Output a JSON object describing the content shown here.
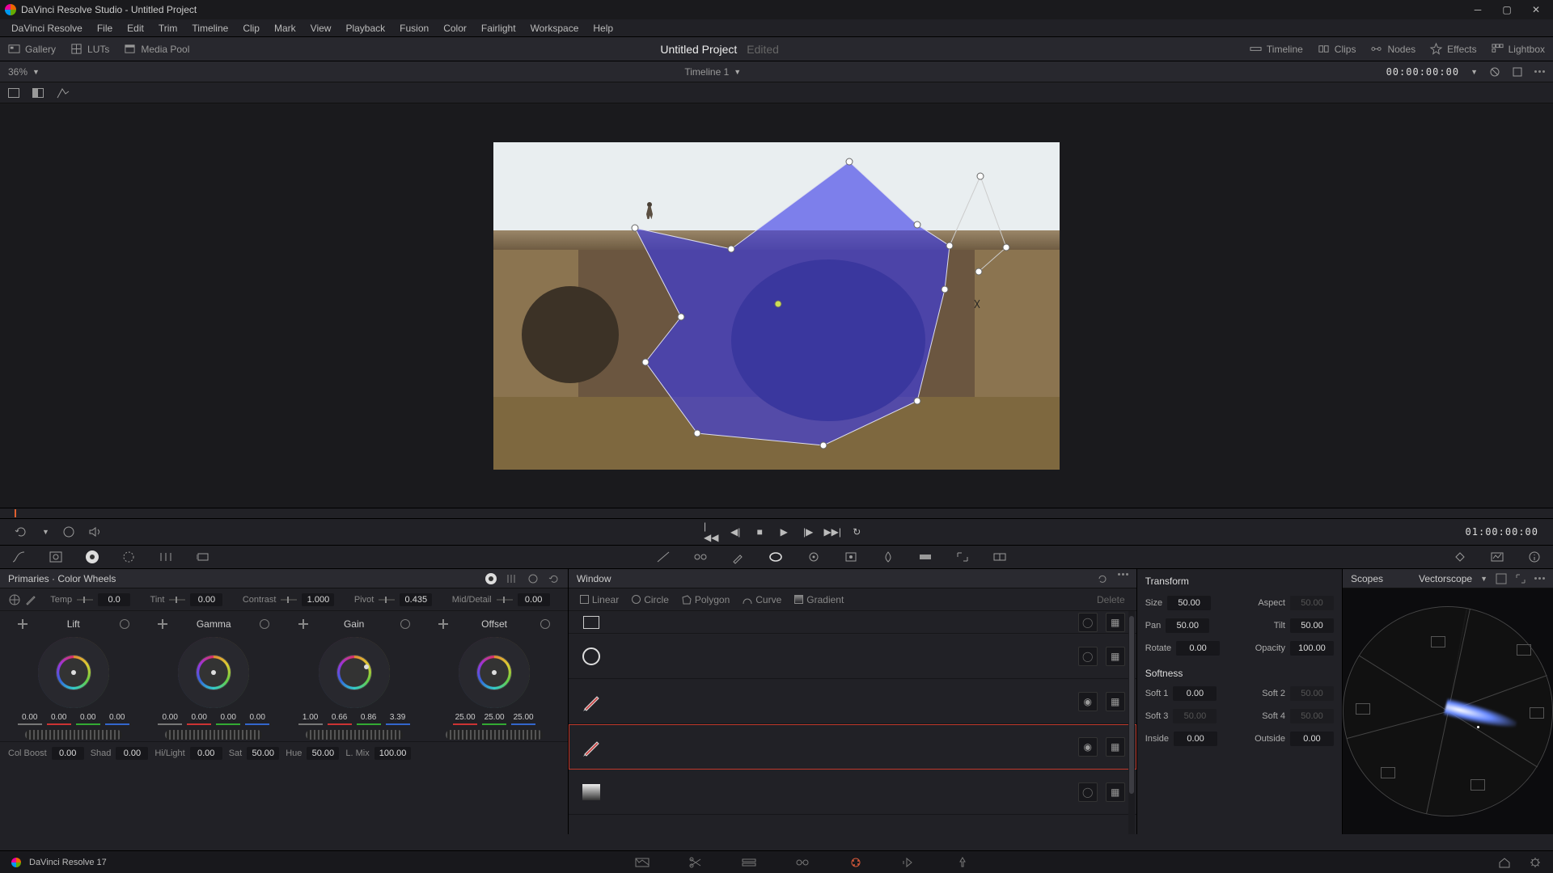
{
  "app_title": "DaVinci Resolve Studio - Untitled Project",
  "menus": [
    "DaVinci Resolve",
    "File",
    "Edit",
    "Trim",
    "Timeline",
    "Clip",
    "Mark",
    "View",
    "Playback",
    "Fusion",
    "Color",
    "Fairlight",
    "Workspace",
    "Help"
  ],
  "toprow": {
    "left": [
      {
        "icon": "gallery",
        "label": "Gallery"
      },
      {
        "icon": "luts",
        "label": "LUTs"
      },
      {
        "icon": "mediapool",
        "label": "Media Pool"
      }
    ],
    "title": "Untitled Project",
    "status": "Edited",
    "right": [
      {
        "icon": "timeline",
        "label": "Timeline"
      },
      {
        "icon": "clips",
        "label": "Clips"
      },
      {
        "icon": "nodes",
        "label": "Nodes"
      },
      {
        "icon": "effects",
        "label": "Effects"
      },
      {
        "icon": "lightbox",
        "label": "Lightbox"
      }
    ]
  },
  "subrow": {
    "zoom": "36%",
    "timeline": "Timeline 1",
    "tc": "00:00:00:00"
  },
  "transport": {
    "tc": "01:00:00:00"
  },
  "primaries": {
    "title": "Primaries · Color Wheels",
    "adjust": {
      "temp_label": "Temp",
      "temp": "0.0",
      "tint_label": "Tint",
      "tint": "0.00",
      "contrast_label": "Contrast",
      "contrast": "1.000",
      "pivot_label": "Pivot",
      "pivot": "0.435",
      "md_label": "Mid/Detail",
      "md": "0.00"
    },
    "wheels": [
      {
        "name": "Lift",
        "v": [
          "0.00",
          "0.00",
          "0.00",
          "0.00"
        ]
      },
      {
        "name": "Gamma",
        "v": [
          "0.00",
          "0.00",
          "0.00",
          "0.00"
        ]
      },
      {
        "name": "Gain",
        "v": [
          "1.00",
          "0.66",
          "0.86",
          "3.39"
        ]
      },
      {
        "name": "Offset",
        "v": [
          "25.00",
          "25.00",
          "25.00"
        ]
      }
    ],
    "bottom": {
      "colboost_label": "Col Boost",
      "colboost": "0.00",
      "shad_label": "Shad",
      "shad": "0.00",
      "hilight_label": "Hi/Light",
      "hilight": "0.00",
      "sat_label": "Sat",
      "sat": "50.00",
      "hue_label": "Hue",
      "hue": "50.00",
      "lmix_label": "L. Mix",
      "lmix": "100.00"
    }
  },
  "window": {
    "title": "Window",
    "tools": {
      "linear": "Linear",
      "circle": "Circle",
      "polygon": "Polygon",
      "curve": "Curve",
      "gradient": "Gradient",
      "delete": "Delete"
    }
  },
  "transform": {
    "title": "Transform",
    "size_label": "Size",
    "size": "50.00",
    "aspect_label": "Aspect",
    "aspect": "50.00",
    "pan_label": "Pan",
    "pan": "50.00",
    "tilt_label": "Tilt",
    "tilt": "50.00",
    "rotate_label": "Rotate",
    "rotate": "0.00",
    "opacity_label": "Opacity",
    "opacity": "100.00",
    "softness_title": "Softness",
    "s1_label": "Soft 1",
    "s1": "0.00",
    "s2_label": "Soft 2",
    "s2": "50.00",
    "s3_label": "Soft 3",
    "s3": "50.00",
    "s4_label": "Soft 4",
    "s4": "50.00",
    "inside_label": "Inside",
    "inside": "0.00",
    "outside_label": "Outside",
    "outside": "0.00"
  },
  "scopes": {
    "title": "Scopes",
    "mode": "Vectorscope"
  },
  "footer": {
    "app": "DaVinci Resolve 17"
  }
}
